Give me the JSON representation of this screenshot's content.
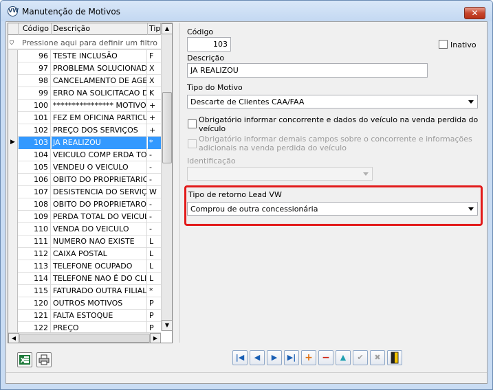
{
  "window": {
    "title": "Manutenção de Motivos",
    "logo_text": "VW",
    "close_label": "✕"
  },
  "grid": {
    "headers": {
      "codigo": "Código",
      "descricao": "Descrição",
      "tipo": "Tipo"
    },
    "filter_placeholder": "Pressione aqui para definir um filtro",
    "rows": [
      {
        "code": "96",
        "desc": "TESTE INCLUSÃO",
        "tipo": "F"
      },
      {
        "code": "97",
        "desc": "PROBLEMA SOLUCIONADO NA",
        "tipo": "X"
      },
      {
        "code": "98",
        "desc": "CANCELAMENTO DE AGENDA",
        "tipo": "X"
      },
      {
        "code": "99",
        "desc": "ERRO NA SOLICITACAO DO",
        "tipo": "K"
      },
      {
        "code": "100",
        "desc": "**************** MOTIVO",
        "tipo": "+"
      },
      {
        "code": "101",
        "desc": "FEZ EM OFICINA PARTICULAR",
        "tipo": "+"
      },
      {
        "code": "102",
        "desc": "PREÇO DOS SERVIÇOS",
        "tipo": "+"
      },
      {
        "code": "103",
        "desc": "JA REALIZOU",
        "tipo": "*"
      },
      {
        "code": "104",
        "desc": "VEICULO COMP ERDA TOTAL",
        "tipo": "-"
      },
      {
        "code": "105",
        "desc": "VENDEU O VEICULO",
        "tipo": "-"
      },
      {
        "code": "106",
        "desc": "OBITO DO PROPRIETARIO",
        "tipo": "-"
      },
      {
        "code": "107",
        "desc": "DESISTENCIA DO SERVIÇO",
        "tipo": "W"
      },
      {
        "code": "108",
        "desc": "OBITO DO PROPRIETAROP",
        "tipo": "-"
      },
      {
        "code": "109",
        "desc": "PERDA TOTAL DO VEICULO",
        "tipo": "-"
      },
      {
        "code": "110",
        "desc": "VENDA DO VEICULO",
        "tipo": "-"
      },
      {
        "code": "111",
        "desc": "NUMERO NAO EXISTE",
        "tipo": "L"
      },
      {
        "code": "112",
        "desc": "CAIXA POSTAL",
        "tipo": "L"
      },
      {
        "code": "113",
        "desc": "TELEFONE OCUPADO",
        "tipo": "L"
      },
      {
        "code": "114",
        "desc": "TELEFONE NAO É DO CLIENTE",
        "tipo": "L"
      },
      {
        "code": "115",
        "desc": "FATURADO OUTRA FILIAL",
        "tipo": "*"
      },
      {
        "code": "120",
        "desc": "OUTROS MOTIVOS",
        "tipo": "P"
      },
      {
        "code": "121",
        "desc": "FALTA ESTOQUE",
        "tipo": "P"
      },
      {
        "code": "122",
        "desc": "PREÇO",
        "tipo": "P"
      }
    ],
    "selected_index": 7
  },
  "form": {
    "codigo_label": "Código",
    "codigo_value": "103",
    "inativo_label": "Inativo",
    "descricao_label": "Descrição",
    "descricao_value": "JA REALIZOU",
    "tipo_motivo_label": "Tipo do Motivo",
    "tipo_motivo_value": "Descarte de Clientes CAA/FAA",
    "chk1_label_line1": "Obrigatório informar concorrente e dados do veículo na venda perdida do",
    "chk1_label_line2": "veículo",
    "chk2_label_line1": "Obrigatório informar demais campos sobre o concorrente e informações",
    "chk2_label_line2": "adicionais na venda perdida do veículo",
    "identificacao_label": "Identificação",
    "identificacao_value": "",
    "retorno_label": "Tipo de retorno Lead VW",
    "retorno_value": "Comprou de outra concessionária"
  },
  "colors": {
    "selection": "#3399ff",
    "highlight_border": "#e21a1a",
    "titlebar": "#c9dcf3"
  }
}
